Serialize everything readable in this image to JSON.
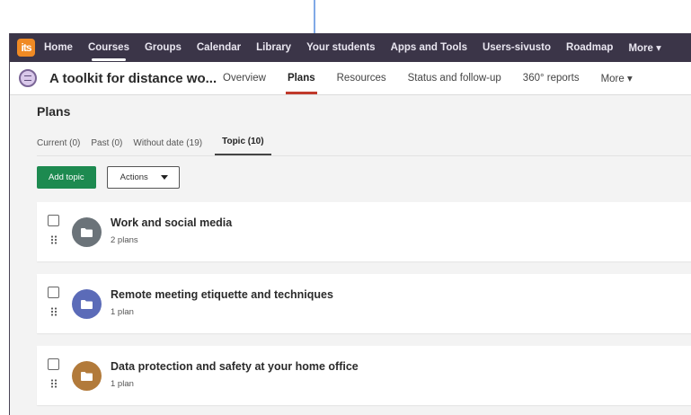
{
  "topnav": {
    "logo": "its",
    "items": [
      "Home",
      "Courses",
      "Groups",
      "Calendar",
      "Library",
      "Your students",
      "Apps and Tools",
      "Users-sivusto",
      "Roadmap",
      "More ▾"
    ]
  },
  "course": {
    "title": "A toolkit for distance wo...",
    "tabs": [
      "Overview",
      "Plans",
      "Resources",
      "Status and follow-up",
      "360° reports",
      "More ▾"
    ]
  },
  "page": {
    "title": "Plans",
    "subtabs": [
      "Current (0)",
      "Past (0)",
      "Without date (19)",
      "Topic (10)"
    ],
    "add_label": "Add topic",
    "actions_label": "Actions"
  },
  "topics": [
    {
      "title": "Work and social media",
      "count": "2 plans",
      "color": "#6b7379"
    },
    {
      "title": "Remote meeting etiquette and techniques",
      "count": "1 plan",
      "color": "#5b6bb8"
    },
    {
      "title": "Data protection and safety at your home office",
      "count": "1 plan",
      "color": "#b27a3a"
    }
  ],
  "colors": {
    "topnav_bg": "#3b3548",
    "add_button": "#1d8a50",
    "active_tab_underline": "#c0392b",
    "logo": "#f08a24",
    "annotation_arrow": "#2c6fd6"
  }
}
